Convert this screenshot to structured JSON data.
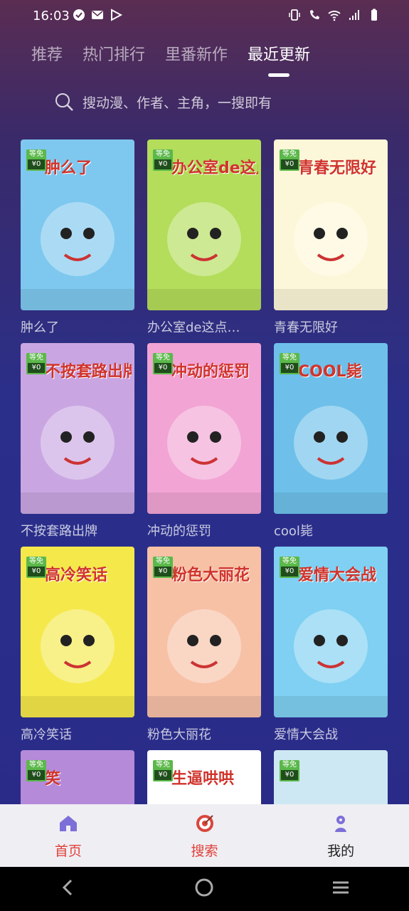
{
  "status": {
    "time": "16:03"
  },
  "tabs": [
    {
      "label": "推荐"
    },
    {
      "label": "热门排行"
    },
    {
      "label": "里番新作"
    },
    {
      "label": "最近更新"
    }
  ],
  "active_tab": 3,
  "search": {
    "placeholder": "搜动漫、作者、主角，一搜即有"
  },
  "badge": {
    "top": "等免",
    "bottom": "¥0"
  },
  "comics": [
    {
      "title": "肿么了",
      "cover_text": "肿么了",
      "bg": "#7ec8ef"
    },
    {
      "title": "办公室de这点…",
      "cover_text": "办公室de这点事儿",
      "bg": "#b3dd5a"
    },
    {
      "title": "青春无限好",
      "cover_text": "青春无限好",
      "bg": "#fdf7d9"
    },
    {
      "title": "不按套路出牌",
      "cover_text": "不按套路出牌",
      "bg": "#c9a6e2"
    },
    {
      "title": "冲动的惩罚",
      "cover_text": "冲动的惩罚",
      "bg": "#f2a4d4"
    },
    {
      "title": "cool毙",
      "cover_text": "COOL毙",
      "bg": "#6ec0ea"
    },
    {
      "title": "高冷笑话",
      "cover_text": "高冷笑话",
      "bg": "#f5e84a"
    },
    {
      "title": "粉色大丽花",
      "cover_text": "粉色大丽花",
      "bg": "#f7c1a6"
    },
    {
      "title": "爱情大会战",
      "cover_text": "爱情大会战",
      "bg": "#7fd0f2"
    },
    {
      "title": "",
      "cover_text": "笑",
      "bg": "#b48ad9"
    },
    {
      "title": "",
      "cover_text": "生逼哄哄",
      "bg": "#ffffff"
    },
    {
      "title": "",
      "cover_text": "",
      "bg": "#cde8f3"
    }
  ],
  "bottom_nav": [
    {
      "label": "首页",
      "icon": "home-icon",
      "color": "#7d6fd8"
    },
    {
      "label": "搜索",
      "icon": "target-icon",
      "color": "#d9463d"
    },
    {
      "label": "我的",
      "icon": "person-icon",
      "color": "#7d6fd8"
    }
  ],
  "colors": {
    "accent": "#e0403a",
    "badge": "#5bb84a"
  }
}
